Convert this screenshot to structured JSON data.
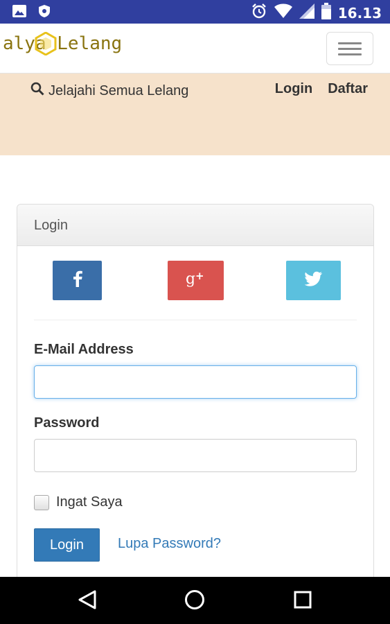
{
  "status_bar": {
    "time": "16.13",
    "left_icons": [
      "image-icon",
      "shield-icon"
    ],
    "right_icons": [
      "alarm-icon",
      "wifi-icon",
      "signal-icon",
      "battery-icon"
    ],
    "bar_color": "#303f9f"
  },
  "navbar": {
    "brand": "alya Lelang",
    "brand_color": "#8a7410",
    "menu_icon": "hamburger-icon"
  },
  "subnav": {
    "background": "#f6e2cb",
    "explore_label": "Jelajahi Semua Lelang",
    "login_label": "Login",
    "register_label": "Daftar"
  },
  "panel": {
    "heading": "Login",
    "social": [
      {
        "network": "facebook",
        "icon": "facebook-icon",
        "color": "#3a6ea8"
      },
      {
        "network": "google-plus",
        "icon": "google-plus-icon",
        "color": "#d9534f"
      },
      {
        "network": "twitter",
        "icon": "twitter-icon",
        "color": "#5bc0de"
      }
    ],
    "email_label": "E-Mail Address",
    "email_value": "",
    "password_label": "Password",
    "password_value": "",
    "remember_label": "Ingat Saya",
    "remember_checked": false,
    "submit_label": "Login",
    "forgot_label": "Lupa Password?",
    "accent_color": "#337ab7"
  },
  "system_nav": {
    "icons": [
      "back-icon",
      "home-icon",
      "recents-icon"
    ]
  }
}
